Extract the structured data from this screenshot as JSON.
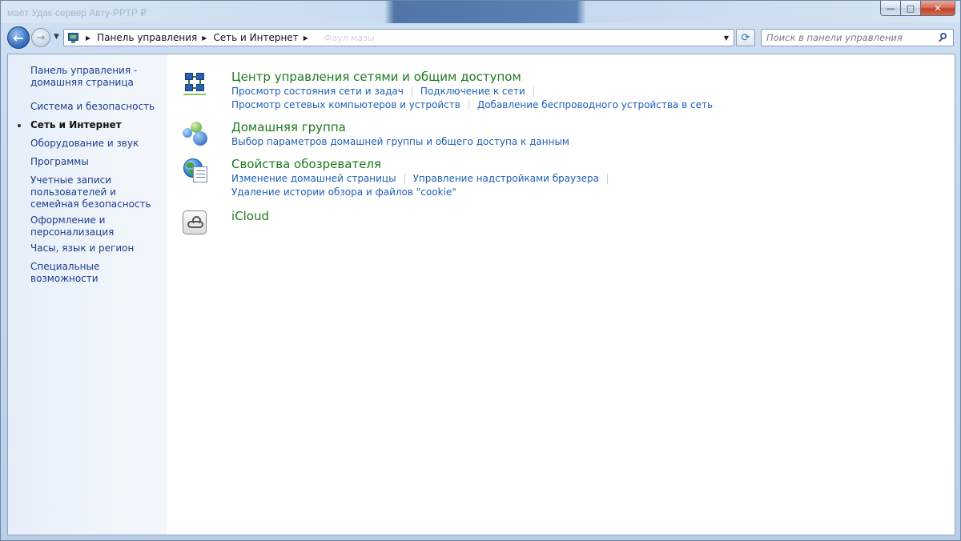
{
  "window": {
    "title_ghost": "маёт Удак-сервер Авту-РРТР ₽",
    "caption_buttons": {
      "minimize": "—",
      "maximize": "□",
      "close": "✕"
    }
  },
  "navigation": {
    "back_icon": "back-arrow-icon",
    "forward_icon": "forward-arrow-icon",
    "history_glyph": "▼",
    "breadcrumb": [
      "Панель управления",
      "Сеть и Интернет"
    ],
    "breadcrumb_ghost": "Фаул мазы",
    "refresh_glyph": "⟳",
    "dropdown_glyph": "▼"
  },
  "search": {
    "placeholder": "Поиск в панели управления"
  },
  "sidebar": {
    "items": [
      {
        "label": "Панель управления - домашняя страница",
        "current": false
      },
      {
        "label": "Система и безопасность",
        "current": false
      },
      {
        "label": "Сеть и Интернет",
        "current": true
      },
      {
        "label": "Оборудование и звук",
        "current": false
      },
      {
        "label": "Программы",
        "current": false
      },
      {
        "label": "Учетные записи пользователей и семейная безопасность",
        "current": false
      },
      {
        "label": "Оформление и персонализация",
        "current": false
      },
      {
        "label": "Часы, язык и регион",
        "current": false
      },
      {
        "label": "Специальные возможности",
        "current": false
      }
    ]
  },
  "sections": [
    {
      "title": "Центр управления сетями и общим доступом",
      "icon": "network-center-icon",
      "rows": [
        [
          "Просмотр состояния сети и задач",
          "Подключение к сети"
        ],
        [
          "Просмотр сетевых компьютеров и устройств",
          "Добавление беспроводного устройства в сеть"
        ]
      ]
    },
    {
      "title": "Домашняя группа",
      "icon": "homegroup-icon",
      "rows": [
        [
          "Выбор параметров домашней группы и общего доступа к данным"
        ]
      ]
    },
    {
      "title": "Свойства обозревателя",
      "icon": "internet-options-icon",
      "rows": [
        [
          "Изменение домашней страницы",
          "Управление надстройками браузера"
        ],
        [
          "Удаление истории обзора и файлов \"cookie\""
        ]
      ]
    },
    {
      "title": "iCloud",
      "icon": "icloud-icon",
      "rows": []
    }
  ],
  "colors": {
    "title_green": "#1d7a1d",
    "link_blue": "#1e5fb6",
    "sidebar_link": "#1e3d8c"
  }
}
